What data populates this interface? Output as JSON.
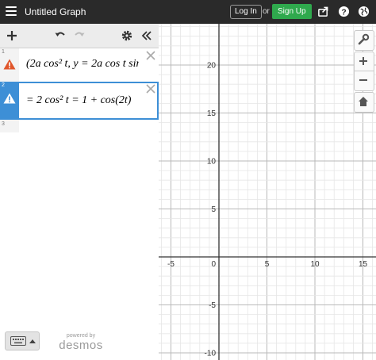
{
  "header": {
    "title": "Untitled Graph",
    "login_label": "Log In",
    "or_label": "or",
    "signup_label": "Sign Up",
    "icons": [
      "menu-icon",
      "share-icon",
      "help-icon",
      "language-icon"
    ]
  },
  "expressions": {
    "toolbar_icons": [
      "add-icon",
      "undo-icon",
      "redo-icon",
      "settings-icon",
      "collapse-icon"
    ],
    "items": [
      {
        "number": "1",
        "latex_text": "(2a cos² t, y = 2a cos t sin",
        "status": "error"
      },
      {
        "number": "2",
        "latex_text": "= 2 cos² t = 1 + cos(2t)",
        "status": "warning",
        "active": true
      },
      {
        "number": "3",
        "latex_text": ""
      }
    ]
  },
  "footer": {
    "powered_by": "powered by",
    "brand": "desmos"
  },
  "graph": {
    "x_tick_labels": [
      "-5",
      "0",
      "5",
      "10",
      "15"
    ],
    "y_tick_labels": [
      "20",
      "15",
      "10",
      "5",
      "-5",
      "-10"
    ],
    "tools": [
      "wrench-icon",
      "zoom-in-icon",
      "zoom-out-icon",
      "home-icon"
    ],
    "grid": true
  }
}
